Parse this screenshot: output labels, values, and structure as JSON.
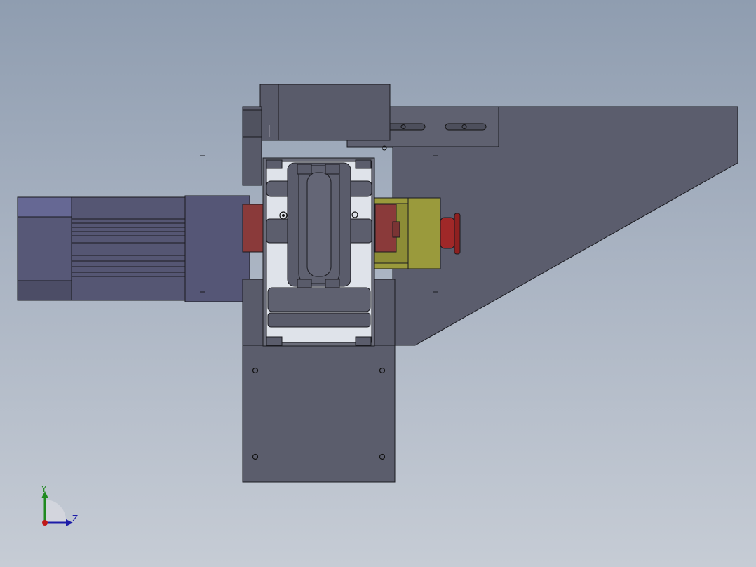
{
  "viewport": {
    "background_top": "#8f9db0",
    "background_bottom": "#c6ccd5"
  },
  "model": {
    "body_color": "#5a5c6b",
    "edge_color": "#1a1a1f",
    "motor_color": "#575877",
    "brake_color": "#8a3a3a",
    "gearbox_color": "#9a9a3c",
    "estop_color": "#a02828"
  },
  "triad": {
    "y_label": "Y",
    "z_label": "Z",
    "y_color": "#1f8a1f",
    "z_color": "#1c1ca8",
    "x_color": "#c01818"
  }
}
